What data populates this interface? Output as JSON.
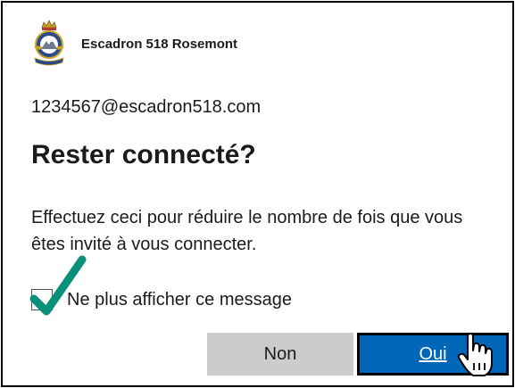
{
  "header": {
    "org_name": "Escadron 518 Rosemont",
    "logo_icon": "squadron-crest-logo"
  },
  "account": {
    "email": "1234567@escadron518.com"
  },
  "dialog": {
    "title": "Rester connecté?",
    "description": "Effectuez ceci pour réduire le nombre de fois que vous êtes invité à vous connecter.",
    "checkbox_label": "Ne plus afficher ce message",
    "checkbox_checked": true
  },
  "buttons": {
    "no_label": "Non",
    "yes_label": "Oui"
  },
  "colors": {
    "primary": "#0067b8",
    "secondary_button": "#cccccc",
    "checkmark": "#0a8f7a"
  }
}
